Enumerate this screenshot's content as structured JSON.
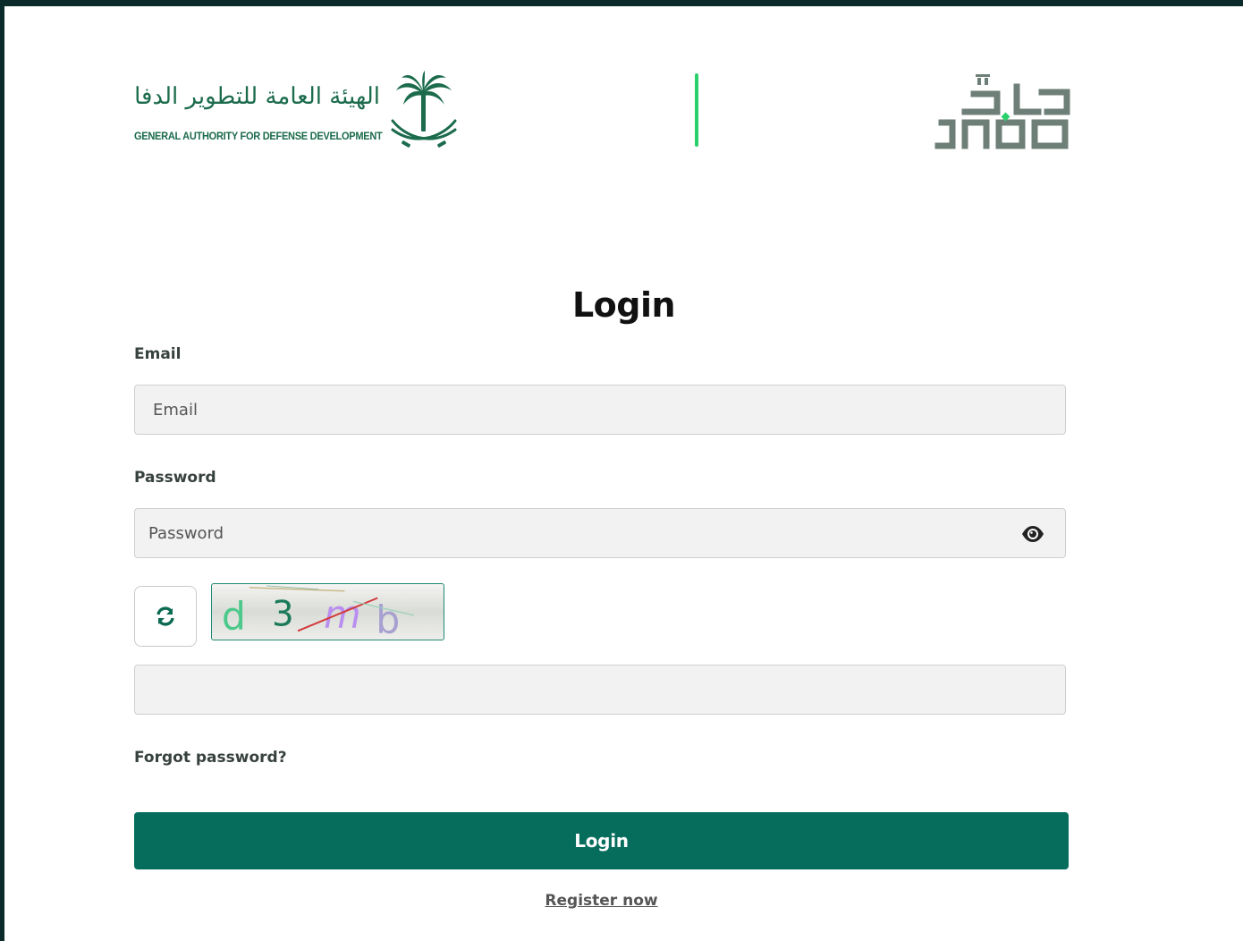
{
  "header": {
    "authority_name_ar": "الهيئة العامة للتطوير الدفاعي",
    "authority_name_en": "GENERAL AUTHORITY FOR DEFENSE DEVELOPMENT",
    "product_logo_text": "JADO",
    "product_logo_ar": "جادّ"
  },
  "form": {
    "title": "Login",
    "email": {
      "label": "Email",
      "placeholder": "Email",
      "value": ""
    },
    "password": {
      "label": "Password",
      "placeholder": "Password",
      "value": ""
    },
    "captcha": {
      "text": "d 3 mb",
      "input_value": ""
    },
    "forgot_password": "Forgot password?",
    "submit_label": "Login",
    "register_label": "Register now"
  },
  "colors": {
    "brand_green": "#066d5c",
    "divider_green": "#2ad06a",
    "logo_green": "#1b6b4c",
    "jado_gray": "#6d7f77"
  },
  "icons": {
    "refresh": "refresh-icon",
    "password_toggle": "eye-icon",
    "emblem": "palm-swords-emblem"
  }
}
